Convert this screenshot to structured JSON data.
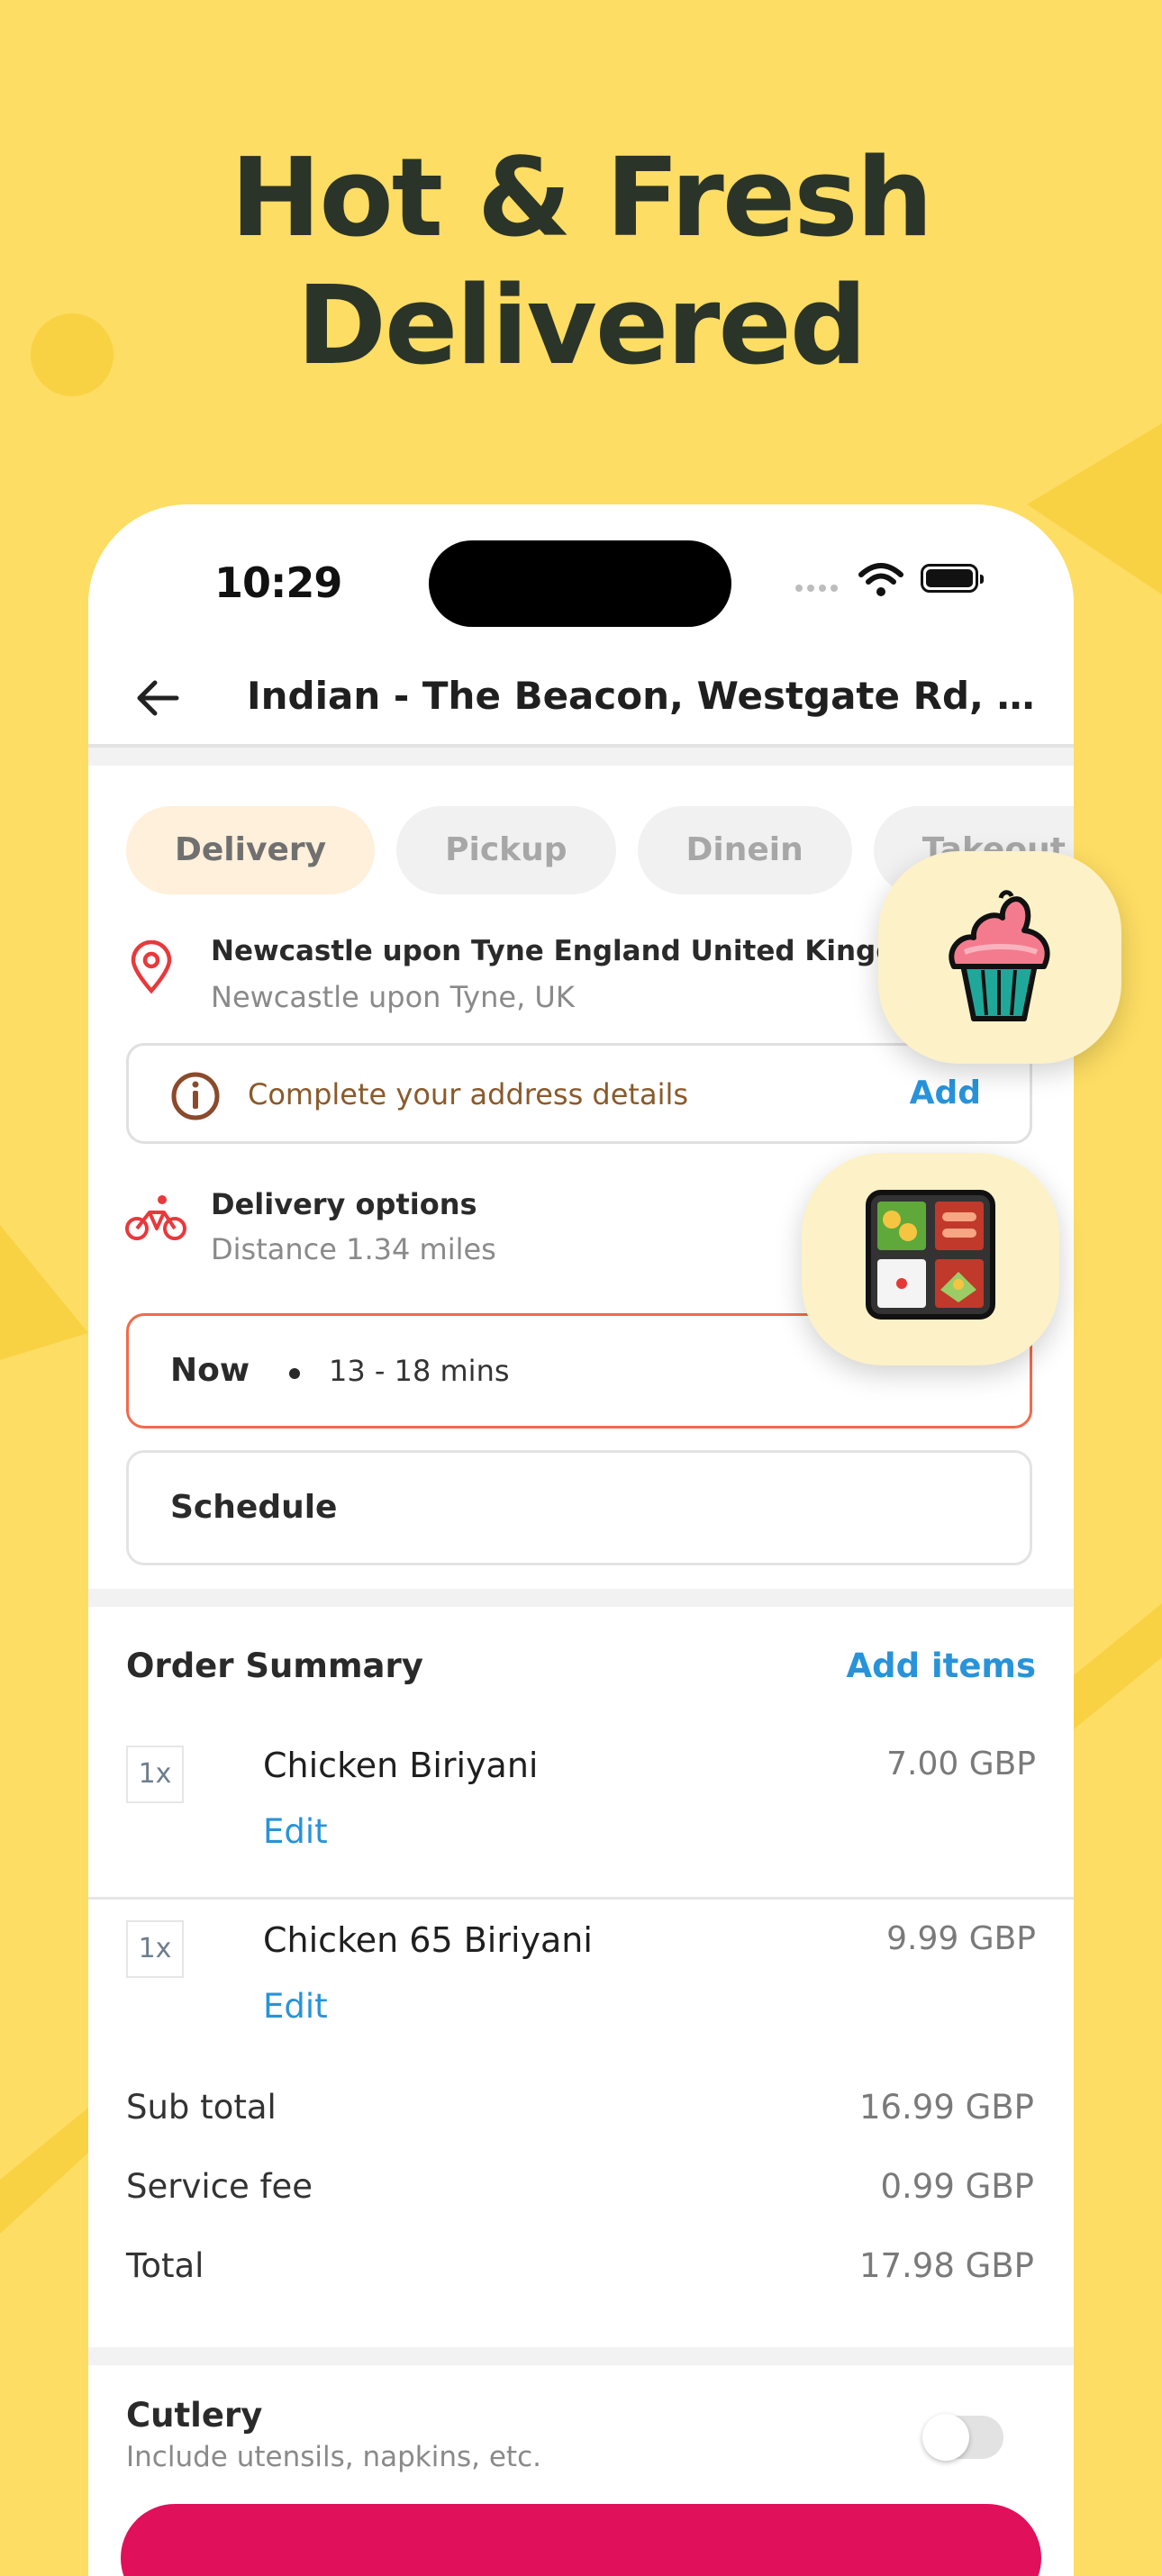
{
  "headline": {
    "line1": "Hot & Fresh",
    "line2": "Delivered"
  },
  "colors": {
    "background": "#FDDD63",
    "accent_blue": "#2893D9",
    "accent_orange": "#F26A4B",
    "brand_pink": "#E0105A"
  },
  "status_bar": {
    "time": "10:29"
  },
  "nav": {
    "title": "Indian - The Beacon, Westgate Rd, Fenha..."
  },
  "order_types": [
    {
      "label": "Delivery",
      "active": true
    },
    {
      "label": "Pickup",
      "active": false
    },
    {
      "label": "Dinein",
      "active": false
    },
    {
      "label": "Takeout",
      "active": false
    }
  ],
  "location": {
    "title": "Newcastle upon Tyne England United Kingdom",
    "subtitle": "Newcastle upon Tyne, UK"
  },
  "address_prompt": {
    "text": "Complete your address details",
    "action": "Add"
  },
  "delivery_options": {
    "title": "Delivery options",
    "distance": "Distance 1.34 miles"
  },
  "timing": {
    "now_label": "Now",
    "now_range": "13 - 18 mins",
    "schedule_label": "Schedule",
    "selected": "now"
  },
  "order_summary": {
    "title": "Order Summary",
    "add_items": "Add items",
    "items": [
      {
        "qty": "1x",
        "name": "Chicken Biriyani",
        "price": "7.00 GBP",
        "edit": "Edit"
      },
      {
        "qty": "1x",
        "name": "Chicken 65 Biriyani",
        "price": "9.99 GBP",
        "edit": "Edit"
      }
    ],
    "subtotal_label": "Sub total",
    "subtotal": "16.99 GBP",
    "service_fee_label": "Service fee",
    "service_fee": "0.99 GBP",
    "total_label": "Total",
    "total": "17.98 GBP"
  },
  "cutlery": {
    "title": "Cutlery",
    "subtitle": "Include utensils, napkins, etc.",
    "enabled": false
  },
  "icons": {
    "cupcake": "cupcake-icon",
    "bento": "bento-box-icon"
  }
}
